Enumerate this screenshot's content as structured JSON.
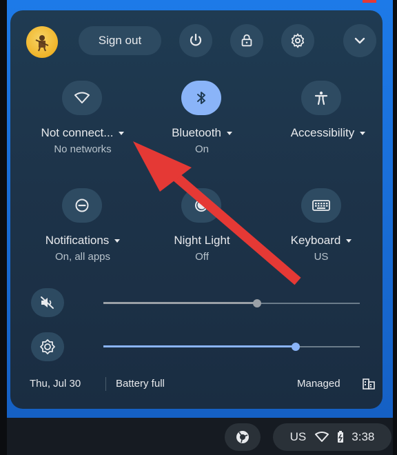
{
  "header": {
    "sign_out_label": "Sign out"
  },
  "tiles": [
    {
      "label": "Not connect...",
      "sub": "No networks",
      "icon": "wifi-icon",
      "active": false
    },
    {
      "label": "Bluetooth",
      "sub": "On",
      "icon": "bluetooth-icon",
      "active": true
    },
    {
      "label": "Accessibility",
      "sub": "",
      "icon": "accessibility-icon",
      "active": false
    },
    {
      "label": "Notifications",
      "sub": "On, all apps",
      "icon": "do-not-disturb-icon",
      "active": false
    },
    {
      "label": "Night Light",
      "sub": "Off",
      "icon": "night-light-icon",
      "active": false
    },
    {
      "label": "Keyboard",
      "sub": "US",
      "icon": "keyboard-icon",
      "active": false
    }
  ],
  "sliders": {
    "volume": {
      "level": 0.6,
      "muted": true,
      "color": "#9aa0a6"
    },
    "brightness": {
      "level": 0.75,
      "color": "#8ab4f8"
    }
  },
  "footer": {
    "date": "Thu, Jul 30",
    "battery": "Battery full",
    "managed": "Managed"
  },
  "shelf": {
    "ime": "US",
    "time": "3:38"
  },
  "colors": {
    "accent": "#8ab4f8",
    "panel": "#1f3b52",
    "annotation_arrow": "#e53935"
  }
}
